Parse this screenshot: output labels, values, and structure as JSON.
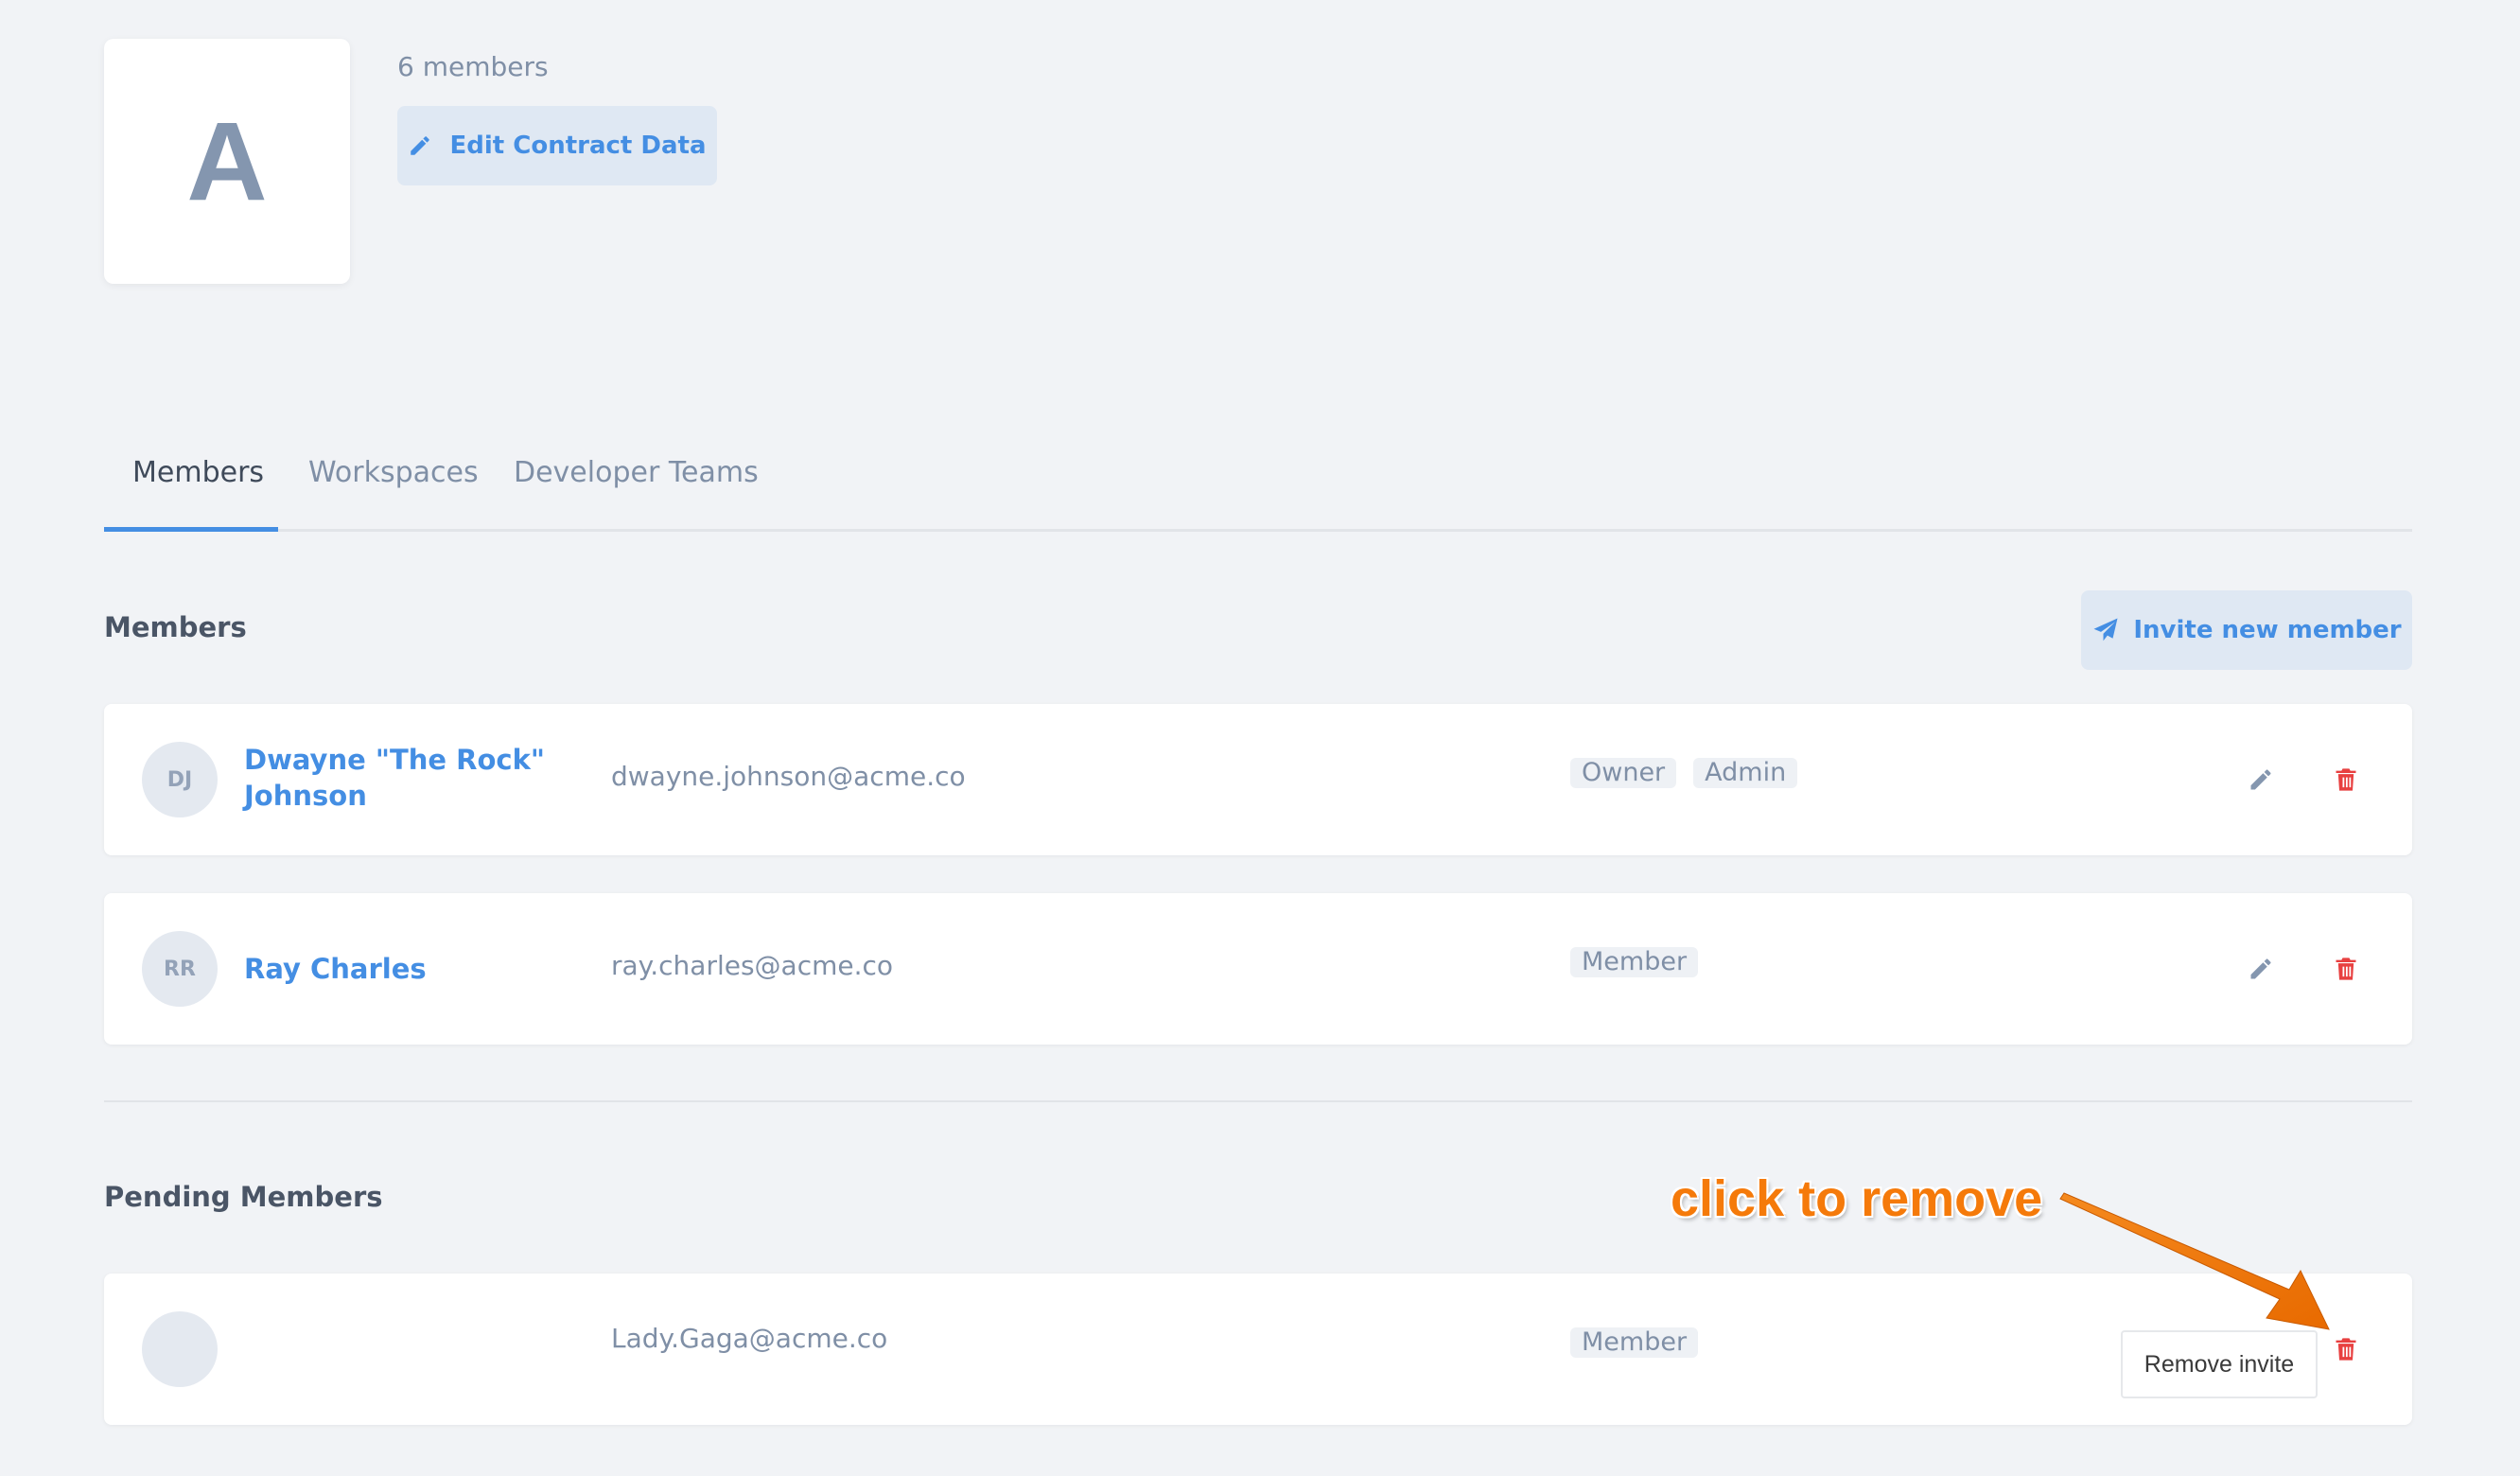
{
  "org": {
    "logo_letter": "A",
    "member_count": "6 members",
    "edit_button_label": "Edit Contract Data"
  },
  "tabs": [
    {
      "label": "Members",
      "active": true
    },
    {
      "label": "Workspaces",
      "active": false
    },
    {
      "label": "Developer Teams",
      "active": false
    }
  ],
  "members_section": {
    "title": "Members",
    "invite_button_label": "Invite new member",
    "members": [
      {
        "initials": "DJ",
        "name_line1": "Dwayne \"The Rock\"",
        "name_line2": "Johnson",
        "email": "dwayne.johnson@acme.co",
        "roles": [
          "Owner",
          "Admin"
        ]
      },
      {
        "initials": "RR",
        "name_line1": "Ray Charles",
        "name_line2": "",
        "email": "ray.charles@acme.co",
        "roles": [
          "Member"
        ]
      }
    ]
  },
  "pending_section": {
    "title": "Pending Members",
    "pending": [
      {
        "initials": "",
        "email": "Lady.Gaga@acme.co",
        "roles": [
          "Member"
        ]
      }
    ]
  },
  "tooltip": {
    "text": "Remove invite"
  },
  "annotation": {
    "text": "click to remove"
  },
  "colors": {
    "accent": "#448ee3",
    "danger": "#e84040",
    "muted": "#7f8fa6",
    "annotation": "#f57a0a"
  }
}
